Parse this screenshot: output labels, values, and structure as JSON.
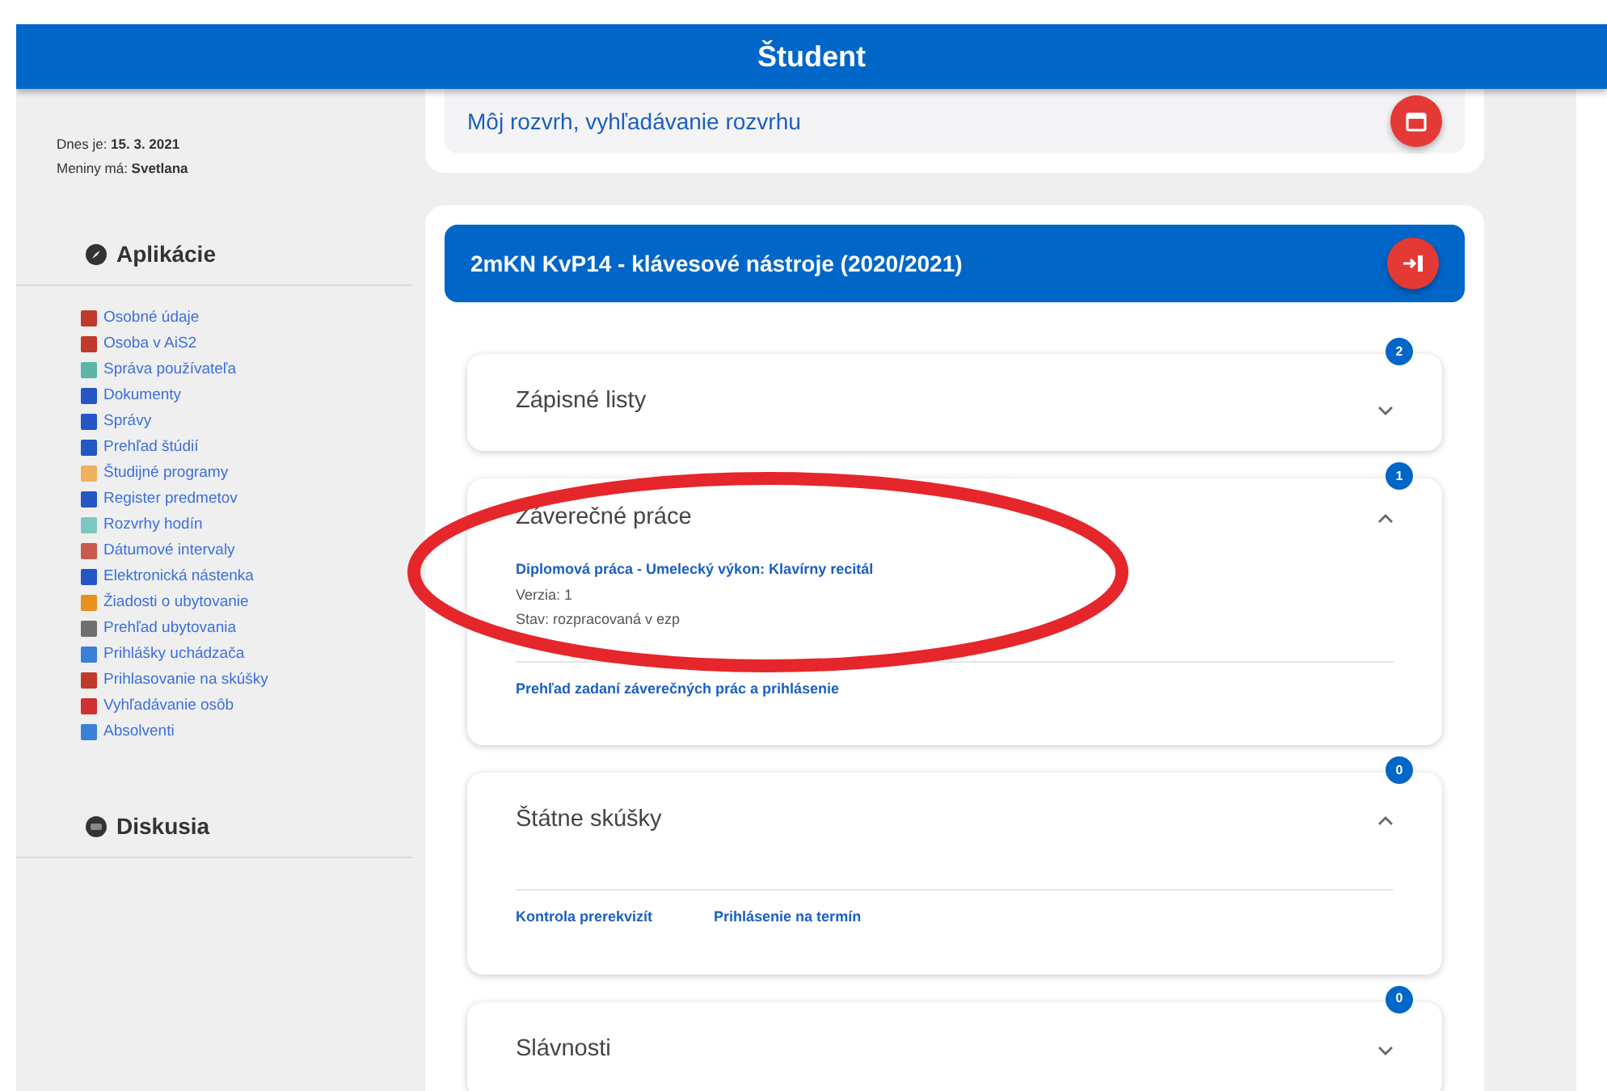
{
  "header": {
    "title": "Študent"
  },
  "sidebar": {
    "today_label": "Dnes je:",
    "today_value": "15. 3. 2021",
    "nameday_label": "Meniny má:",
    "nameday_value": "Svetlana",
    "sections": [
      {
        "title": "Aplikácie",
        "items": [
          {
            "label": "Osobné údaje",
            "color": "#c0392b"
          },
          {
            "label": "Osoba v AiS2",
            "color": "#c0392b"
          },
          {
            "label": "Správa používateľa",
            "color": "#5bb5a8"
          },
          {
            "label": "Dokumenty",
            "color": "#2456c4"
          },
          {
            "label": "Správy",
            "color": "#2456c4"
          },
          {
            "label": "Prehľad štúdií",
            "color": "#2456c4"
          },
          {
            "label": "Študijné programy",
            "color": "#f0b060"
          },
          {
            "label": "Register predmetov",
            "color": "#2456c4"
          },
          {
            "label": "Rozvrhy hodín",
            "color": "#7cc8c0"
          },
          {
            "label": "Dátumové intervaly",
            "color": "#c85a50"
          },
          {
            "label": "Elektronická nástenka",
            "color": "#2456c4"
          },
          {
            "label": "Žiadosti o ubytovanie",
            "color": "#e89020"
          },
          {
            "label": "Prehľad ubytovania",
            "color": "#707070"
          },
          {
            "label": "Prihlášky uchádzača",
            "color": "#3a80d8"
          },
          {
            "label": "Prihlasovanie na skúšky",
            "color": "#c0392b"
          },
          {
            "label": "Vyhľadávanie osôb",
            "color": "#d03030"
          },
          {
            "label": "Absolventi",
            "color": "#3a80d8"
          }
        ]
      },
      {
        "title": "Diskusia"
      }
    ]
  },
  "schedule_link": "Môj rozvrh, vyhľadávanie rozvrhu",
  "study": {
    "title": "2mKN KvP14 - klávesové nástroje (2020/2021)",
    "panels": [
      {
        "title": "Zápisné listy",
        "count": "2",
        "expanded": false
      },
      {
        "title": "Záverečné práce",
        "count": "1",
        "expanded": true,
        "thesis": {
          "title": "Diplomová práca - Umelecký výkon: Klavírny recitál",
          "version": "Verzia: 1",
          "state": "Stav: rozpracovaná v ezp"
        },
        "links": [
          "Prehľad zadaní záverečných prác a prihlásenie"
        ]
      },
      {
        "title": "Štátne skúšky",
        "count": "0",
        "expanded": true,
        "links": [
          "Kontrola prerekvizít",
          "Prihlásenie na termín"
        ]
      },
      {
        "title": "Slávnosti",
        "count": "0",
        "expanded": false
      }
    ]
  },
  "annotation": {
    "kind": "ellipse",
    "color": "#e5262b"
  }
}
